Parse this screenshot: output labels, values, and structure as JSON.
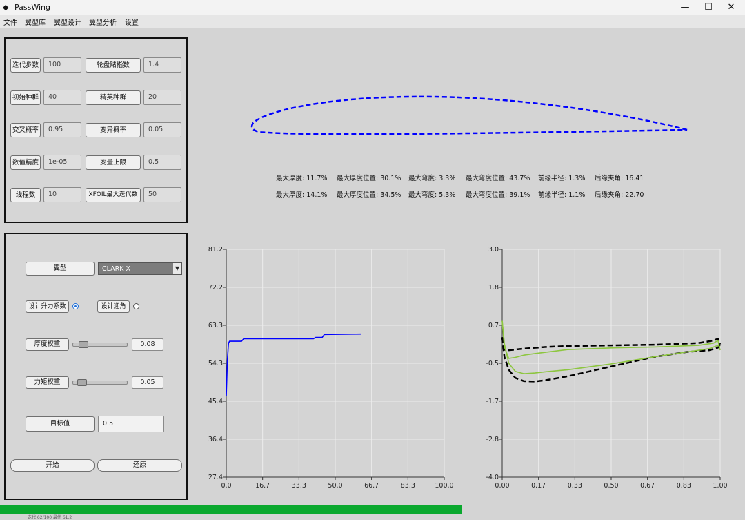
{
  "window": {
    "title": "PassWing",
    "minimize": "—",
    "maximize": "☐",
    "close": "✕",
    "icon": "app-cube-icon"
  },
  "menu": {
    "items": [
      "文件",
      "翼型库",
      "翼型设计",
      "翼型分析",
      "设置"
    ]
  },
  "params": {
    "iter_label": "迭代步数",
    "iter_value": "100",
    "roulette_label": "轮盘赌指数",
    "roulette_value": "1.4",
    "init_pop_label": "初始种群",
    "init_pop_value": "40",
    "elite_label": "精英种群",
    "elite_value": "20",
    "crossover_label": "交叉概率",
    "crossover_value": "0.95",
    "mutation_label": "变异概率",
    "mutation_value": "0.05",
    "precision_label": "数值精度",
    "precision_value": "1e-05",
    "var_upper_label": "变量上限",
    "var_upper_value": "0.5",
    "threads_label": "线程数",
    "threads_value": "10",
    "xfoil_label": "XFOIL最大迭代数",
    "xfoil_value": "50"
  },
  "design": {
    "airfoil_label": "翼型",
    "airfoil_value": "CLARK X",
    "design_cl_label": "设计升力系数",
    "design_aoa_label": "设计迎角",
    "selected_mode": "design_cl",
    "thickness_weight_label": "厚度权重",
    "thickness_weight_value": "0.08",
    "thickness_weight_level": 0.08,
    "moment_weight_label": "力矩权重",
    "moment_weight_value": "0.05",
    "moment_weight_level": 0.05,
    "target_label": "目标值",
    "target_value": "0.5",
    "start_label": "开始",
    "reset_label": "还原"
  },
  "stats": {
    "row1": [
      {
        "label": "最大厚度:",
        "value": "11.7%"
      },
      {
        "label": "最大厚度位置:",
        "value": "30.1%"
      },
      {
        "label": "最大弯度:",
        "value": "3.3%"
      },
      {
        "label": "最大弯度位置:",
        "value": "43.7%"
      },
      {
        "label": "前缘半径:",
        "value": "1.3%"
      },
      {
        "label": "后缘夹角:",
        "value": "16.41"
      }
    ],
    "row2": [
      {
        "label": "最大厚度:",
        "value": "14.1%"
      },
      {
        "label": "最大厚度位置:",
        "value": "34.5%"
      },
      {
        "label": "最大弯度:",
        "value": "5.3%"
      },
      {
        "label": "最大弯度位置:",
        "value": "39.1%"
      },
      {
        "label": "前缘半径:",
        "value": "1.1%"
      },
      {
        "label": "后缘夹角:",
        "value": "22.70"
      }
    ]
  },
  "progress": {
    "fraction": 0.62,
    "color": "#0aa82e",
    "status_text": "迭代 62/100   最优 61.2"
  },
  "chart_data": [
    {
      "type": "line",
      "title": "",
      "xlabel": "",
      "ylabel": "",
      "xlim": [
        0,
        100
      ],
      "ylim": [
        27.4,
        81.2
      ],
      "xticks": [
        "0.0",
        "16.7",
        "33.3",
        "50.0",
        "66.7",
        "83.3",
        "100.0"
      ],
      "yticks": [
        "27.4",
        "36.4",
        "45.4",
        "54.3",
        "63.3",
        "72.2",
        "81.2"
      ],
      "grid": true,
      "series": [
        {
          "color": "#0000ff",
          "x": [
            0,
            0.5,
            1,
            1.5,
            2,
            7,
            8,
            40,
            41,
            44,
            45,
            62
          ],
          "y": [
            46.5,
            55,
            59,
            59.5,
            59.5,
            59.5,
            60.1,
            60.1,
            60.4,
            60.4,
            61.1,
            61.2
          ]
        }
      ]
    },
    {
      "type": "line",
      "title": "",
      "xlabel": "",
      "ylabel": "",
      "xlim": [
        0,
        1
      ],
      "ylim": [
        -4.0,
        3.0
      ],
      "xticks": [
        "0.00",
        "0.17",
        "0.33",
        "0.50",
        "0.67",
        "0.83",
        "1.00"
      ],
      "yticks": [
        "-4.0",
        "-2.8",
        "-1.7",
        "-0.5",
        "0.7",
        "1.8",
        "3.0"
      ],
      "grid": true,
      "series": [
        {
          "color": "#000000",
          "dashed": true,
          "x": [
            0,
            0.01,
            0.03,
            0.1,
            0.2,
            0.3,
            0.5,
            0.7,
            0.9,
            0.97,
            0.99,
            1.0
          ],
          "y": [
            0.3,
            -0.08,
            -0.1,
            -0.05,
            0.0,
            0.03,
            0.05,
            0.07,
            0.12,
            0.2,
            0.25,
            0.08
          ]
        },
        {
          "color": "#000000",
          "dashed": true,
          "x": [
            0,
            0.01,
            0.03,
            0.06,
            0.1,
            0.15,
            0.2,
            0.3,
            0.5,
            0.7,
            0.85,
            0.95,
            0.99,
            1.0
          ],
          "y": [
            0.3,
            -0.3,
            -0.7,
            -0.95,
            -1.05,
            -1.06,
            -1.02,
            -0.9,
            -0.6,
            -0.3,
            -0.15,
            -0.1,
            -0.02,
            0.08
          ]
        },
        {
          "color": "#8dc63f",
          "x": [
            0,
            0.01,
            0.03,
            0.06,
            0.1,
            0.15,
            0.3,
            0.5,
            0.7,
            0.9,
            0.97,
            0.99,
            1.0
          ],
          "y": [
            0.8,
            0.0,
            -0.35,
            -0.32,
            -0.25,
            -0.2,
            -0.08,
            -0.03,
            0.0,
            0.05,
            0.12,
            0.2,
            -0.1
          ]
        },
        {
          "color": "#8dc63f",
          "x": [
            0,
            0.01,
            0.03,
            0.06,
            0.1,
            0.15,
            0.2,
            0.3,
            0.5,
            0.7,
            0.85,
            0.95,
            0.99,
            1.0
          ],
          "y": [
            0.8,
            0.1,
            -0.5,
            -0.75,
            -0.82,
            -0.8,
            -0.76,
            -0.7,
            -0.52,
            -0.3,
            -0.15,
            -0.05,
            0.05,
            0.0
          ]
        }
      ]
    }
  ]
}
